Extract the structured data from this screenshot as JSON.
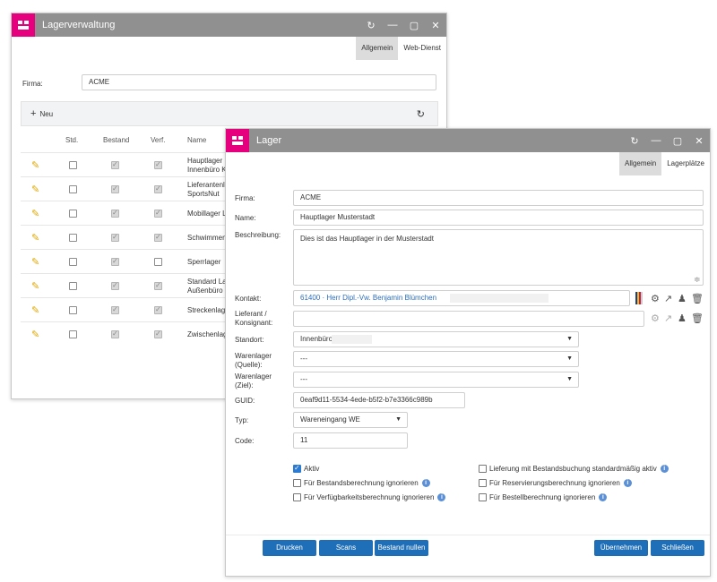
{
  "back_window": {
    "title": "Lagerverwaltung",
    "tabs": [
      "Allgemein",
      "Web-Dienst"
    ],
    "firma_label": "Firma:",
    "firma_value": "ACME",
    "new_label": "Neu",
    "columns": [
      "Std.",
      "Bestand",
      "Verf.",
      "Name"
    ],
    "rows": [
      {
        "std": false,
        "bestand": true,
        "verf": true,
        "name1": "Hauptlager M",
        "name2": "Innenbüro K"
      },
      {
        "std": false,
        "bestand": true,
        "verf": true,
        "name1": "Lieferantenl",
        "name2": "SportsNut"
      },
      {
        "std": false,
        "bestand": true,
        "verf": true,
        "name1": "Mobillager L",
        "name2": ""
      },
      {
        "std": false,
        "bestand": true,
        "verf": true,
        "name1": "Schwimmen",
        "name2": ""
      },
      {
        "std": false,
        "bestand": true,
        "verf": false,
        "name1": "Sperrlager",
        "name2": ""
      },
      {
        "std": false,
        "bestand": true,
        "verf": true,
        "name1": "Standard La",
        "name2": "Außenbüro S"
      },
      {
        "std": false,
        "bestand": true,
        "verf": true,
        "name1": "Streckenlag",
        "name2": ""
      },
      {
        "std": false,
        "bestand": true,
        "verf": true,
        "name1": "Zwischenlag",
        "name2": ""
      }
    ]
  },
  "front_window": {
    "title": "Lager",
    "tabs": [
      "Allgemein",
      "Lagerplätze"
    ],
    "fields": {
      "firma_label": "Firma:",
      "firma_value": "ACME",
      "name_label": "Name:",
      "name_value": "Hauptlager Musterstadt",
      "beschreibung_label": "Beschreibung:",
      "beschreibung_value": "Dies ist das Hauptlager in der Musterstadt",
      "kontakt_label": "Kontakt:",
      "kontakt_value": "61400 · Herr Dipl.-Vw. Benjamin Blümchen",
      "lieferant_label1": "Lieferant /",
      "lieferant_label2": "Konsignant:",
      "lieferant_value": "",
      "standort_label": "Standort:",
      "standort_value": "Innenbüro",
      "quelle_label1": "Warenlager",
      "quelle_label2": "(Quelle):",
      "quelle_value": "---",
      "ziel_label1": "Warenlager",
      "ziel_label2": "(Ziel):",
      "ziel_value": "---",
      "guid_label": "GUID:",
      "guid_value": "0eaf9d11-5534-4ede-b5f2-b7e3366c989b",
      "typ_label": "Typ:",
      "typ_value": "Wareneingang WE",
      "code_label": "Code:",
      "code_value": "11"
    },
    "checkboxes": {
      "aktiv": {
        "label": "Aktiv",
        "checked": true
      },
      "bestand": {
        "label": "Für Bestandsberechnung ignorieren",
        "checked": false
      },
      "verf": {
        "label": "Für Verfügbarkeitsberechnung ignorieren",
        "checked": false
      },
      "lieferung": {
        "label": "Lieferung mit Bestandsbuchung standardmäßig aktiv",
        "checked": false
      },
      "reserv": {
        "label": "Für Reservierungsberechnung ignorieren",
        "checked": false
      },
      "bestell": {
        "label": "Für Bestellberechnung ignorieren",
        "checked": false
      }
    },
    "buttons": {
      "drucken": "Drucken",
      "scans": "Scans",
      "bestand_nullen": "Bestand nullen",
      "uebernehmen": "Übernehmen",
      "schliessen": "Schließen"
    }
  },
  "colors": {
    "accent": "#e6007e",
    "button": "#1f6fb8",
    "titlebar": "#909090"
  }
}
